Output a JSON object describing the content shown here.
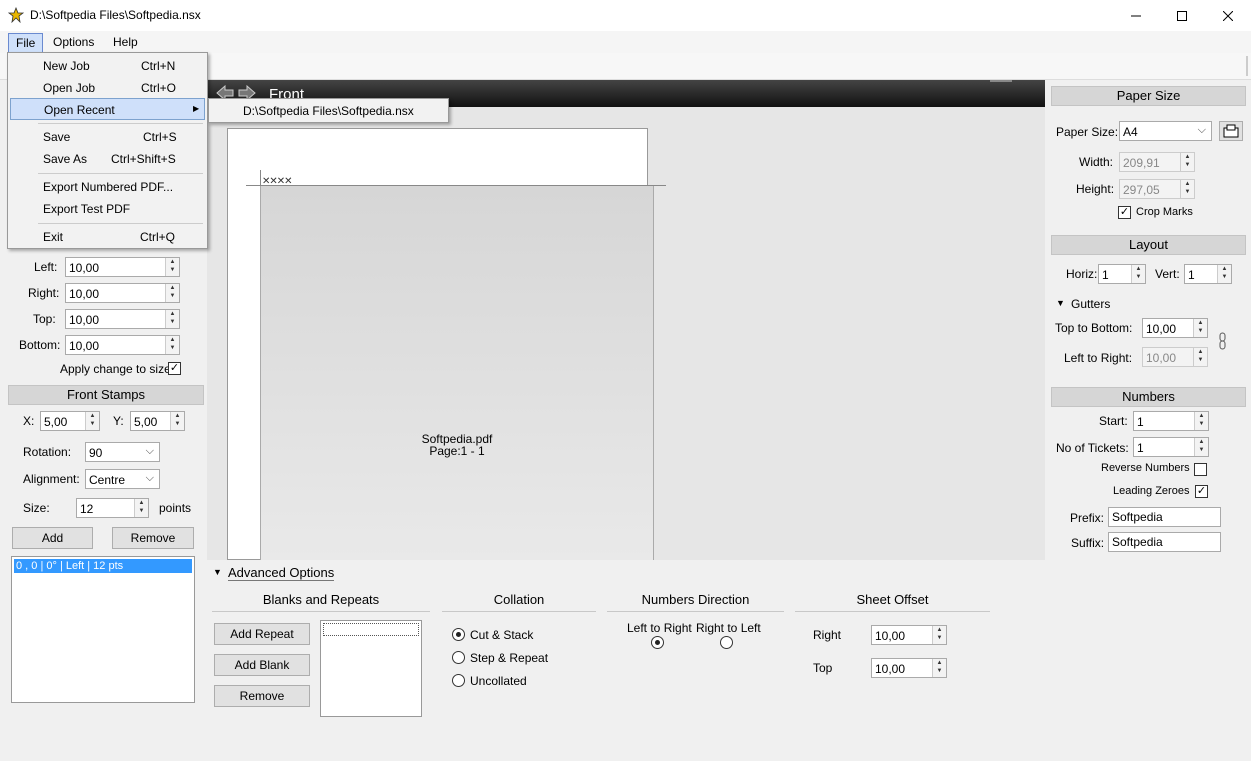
{
  "window": {
    "title": "D:\\Softpedia Files\\Softpedia.nsx"
  },
  "menubar": {
    "file": "File",
    "options": "Options",
    "help": "Help"
  },
  "file_menu": {
    "items": [
      {
        "label": "New Job",
        "shortcut": "Ctrl+N"
      },
      {
        "label": "Open Job",
        "shortcut": "Ctrl+O"
      },
      {
        "label": "Open Recent",
        "shortcut": ""
      },
      {
        "label": "Save",
        "shortcut": "Ctrl+S"
      },
      {
        "label": "Save As",
        "shortcut": "Ctrl+Shift+S"
      },
      {
        "label": "Export Numbered PDF...",
        "shortcut": ""
      },
      {
        "label": "Export Test PDF",
        "shortcut": ""
      },
      {
        "label": "Exit",
        "shortcut": "Ctrl+Q"
      }
    ],
    "recent": "D:\\Softpedia Files\\Softpedia.nsx"
  },
  "canvas": {
    "title": "Front",
    "ticket_name": "Softpedia.pdf",
    "ticket_page": "Page:1 - 1"
  },
  "margins": {
    "left_label": "Left:",
    "left": "10,00",
    "right_label": "Right:",
    "right": "10,00",
    "top_label": "Top:",
    "top": "10,00",
    "bottom_label": "Bottom:",
    "bottom": "10,00",
    "apply_label": "Apply change to size"
  },
  "front_stamps": {
    "header": "Front Stamps",
    "x_label": "X:",
    "x": "5,00",
    "y_label": "Y:",
    "y": "5,00",
    "rotation_label": "Rotation:",
    "rotation": "90",
    "alignment_label": "Alignment:",
    "alignment": "Centre",
    "size_label": "Size:",
    "size": "12",
    "size_unit": "points",
    "add": "Add",
    "remove": "Remove",
    "list": [
      "0 , 0 | 0° | Left | 12 pts"
    ]
  },
  "paper_size": {
    "header": "Paper Size",
    "size_label": "Paper Size:",
    "size": "A4",
    "width_label": "Width:",
    "width": "209,91",
    "height_label": "Height:",
    "height": "297,05",
    "crop_label": "Crop Marks"
  },
  "layout": {
    "header": "Layout",
    "horiz_label": "Horiz:",
    "horiz": "1",
    "vert_label": "Vert:",
    "vert": "1",
    "gutters_label": "Gutters",
    "ttb_label": "Top to Bottom:",
    "ttb": "10,00",
    "ltr_label": "Left to Right:",
    "ltr": "10,00"
  },
  "numbers": {
    "header": "Numbers",
    "start_label": "Start:",
    "start": "1",
    "tickets_label": "No of Tickets:",
    "tickets": "1",
    "reverse_label": "Reverse Numbers",
    "leading_label": "Leading Zeroes",
    "prefix_label": "Prefix:",
    "prefix": "Softpedia",
    "suffix_label": "Suffix:",
    "suffix": "Softpedia"
  },
  "advanced": {
    "toggle": "Advanced Options",
    "blanks_title": "Blanks and Repeats",
    "add_repeat": "Add Repeat",
    "add_blank": "Add Blank",
    "remove": "Remove",
    "collation_title": "Collation",
    "cut_stack": "Cut & Stack",
    "step_repeat": "Step & Repeat",
    "uncollated": "Uncollated",
    "direction_title": "Numbers Direction",
    "ltr": "Left to Right",
    "rtl": "Right to Left",
    "offset_title": "Sheet Offset",
    "right_label": "Right",
    "right": "10,00",
    "top_label": "Top",
    "top": "10,00"
  },
  "colors": {
    "selection": "#3399ff",
    "menu_highlight": "#cfe0fa",
    "canvas_header": "#1a1a1a"
  }
}
